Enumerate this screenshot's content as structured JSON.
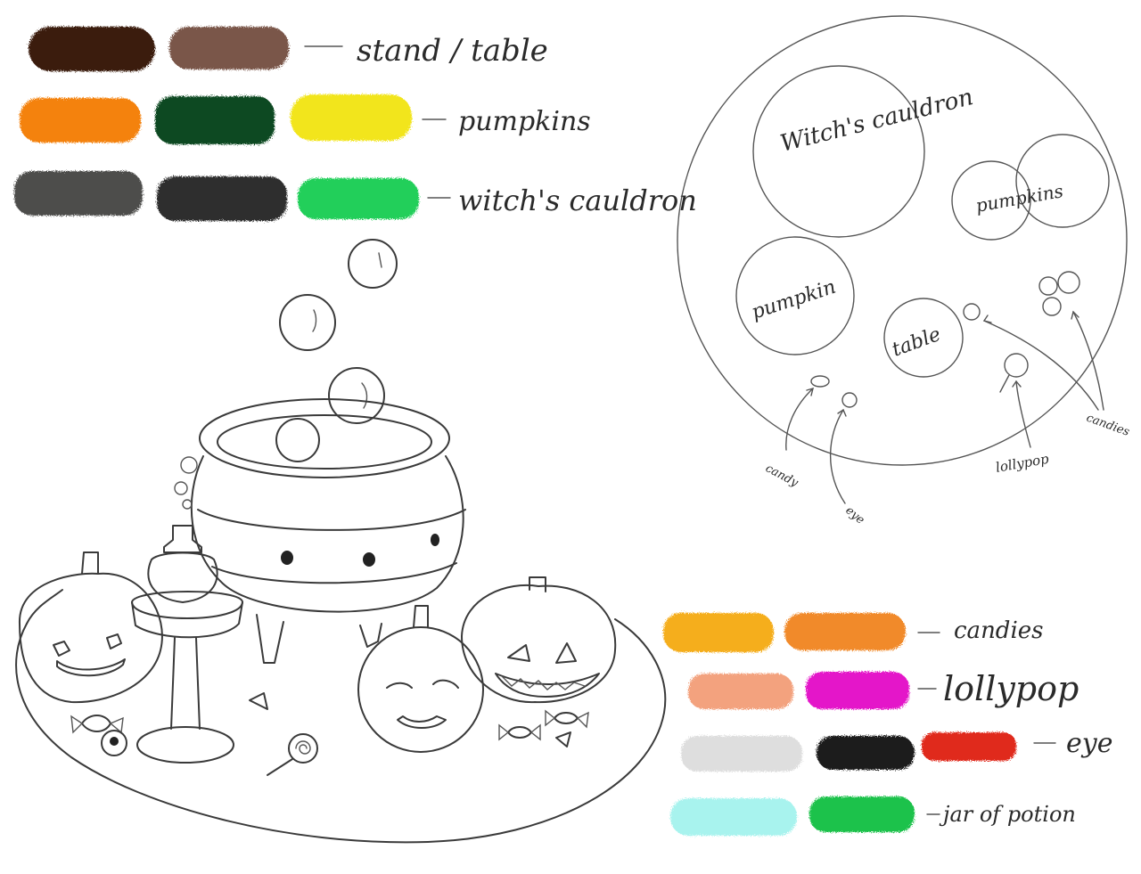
{
  "palette_rows": [
    {
      "label": "stand / table",
      "colors": [
        "#3b1a0c",
        "#7a5648"
      ]
    },
    {
      "label": "pumpkins",
      "colors": [
        "#f4820c",
        "#0e4a20",
        "#f2e51a"
      ]
    },
    {
      "label": "witch's cauldron",
      "colors": [
        "#4e4e4c",
        "#2d2d2d",
        "#21cf5a"
      ]
    },
    {
      "label": "candies",
      "colors": [
        "#f5ae1f",
        "#f18a2a"
      ]
    },
    {
      "label": "lollypop",
      "colors": [
        "#f3a27e",
        "#e414c9"
      ]
    },
    {
      "label": "eye",
      "colors": [
        "#dedede",
        "#1a1a1a",
        "#e02a1c"
      ]
    },
    {
      "label": "jar of potion",
      "colors": [
        "#a8f3ee",
        "#1fc24c"
      ]
    }
  ],
  "composition": {
    "cauldron_label": "Witch's cauldron",
    "pumpkins_label": "pumpkins",
    "pumpkin_label": "pumpkin",
    "table_label": "table",
    "candy_label": "candy",
    "eye_label": "eye",
    "lollypop_label": "lollypop",
    "candies_label": "candies"
  }
}
